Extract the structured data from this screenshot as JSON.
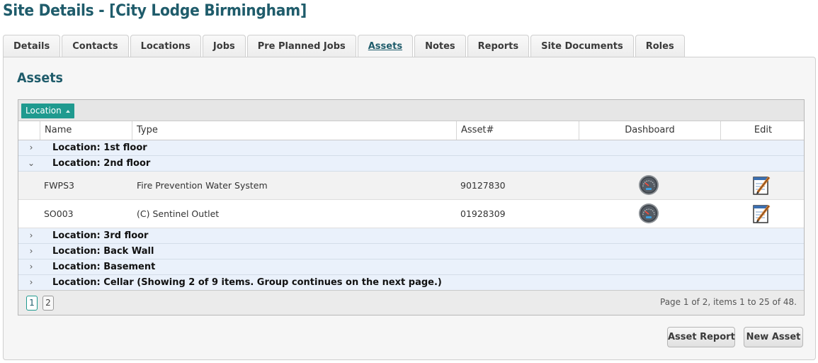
{
  "page": {
    "title": "Site Details - [City Lodge Birmingham]"
  },
  "tabs": [
    {
      "label": "Details"
    },
    {
      "label": "Contacts"
    },
    {
      "label": "Locations"
    },
    {
      "label": "Jobs"
    },
    {
      "label": "Pre Planned Jobs"
    },
    {
      "label": "Assets",
      "active": true
    },
    {
      "label": "Notes"
    },
    {
      "label": "Reports"
    },
    {
      "label": "Site Documents"
    },
    {
      "label": "Roles"
    }
  ],
  "assets": {
    "section_title": "Assets",
    "group_chip": "Location",
    "columns": {
      "name": "Name",
      "type": "Type",
      "asset": "Asset#",
      "dashboard": "Dashboard",
      "edit": "Edit"
    },
    "groups": [
      {
        "label": "Location: 1st floor",
        "chevron": "›"
      },
      {
        "label": "Location: 2nd floor",
        "chevron": "⌄"
      },
      {
        "label": "Location: 3rd floor",
        "chevron": "›"
      },
      {
        "label": "Location: Back Wall",
        "chevron": "›"
      },
      {
        "label": "Location: Basement",
        "chevron": "›"
      },
      {
        "label": "Location: Cellar (Showing 2 of 9 items. Group continues on the next page.)",
        "chevron": "›"
      }
    ],
    "rows": [
      {
        "name": "FWPS3",
        "type": "Fire Prevention Water System",
        "asset": "90127830"
      },
      {
        "name": "SO003",
        "type": "(C) Sentinel Outlet",
        "asset": "01928309"
      }
    ],
    "pager": {
      "pages": [
        "1",
        "2"
      ],
      "current": "1",
      "info": "Page 1 of 2, items 1 to 25 of 48."
    }
  },
  "buttons": {
    "asset_report": "Asset Report",
    "new_asset": "New Asset"
  },
  "colors": {
    "brand": "#1f5c6b",
    "accent": "#1f9a8f",
    "group_row": "#eaf1fb"
  },
  "icons": {
    "dashboard": "gauge-icon",
    "edit": "edit-notepad-icon",
    "expanded": "chevron-down-icon",
    "collapsed": "chevron-right-icon"
  }
}
